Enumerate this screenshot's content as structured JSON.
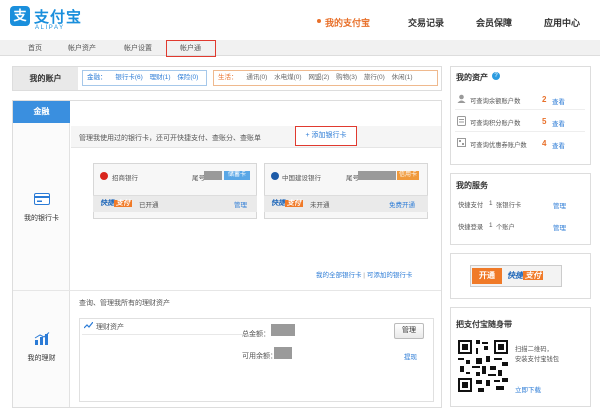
{
  "brand": {
    "logo_glyph": "支",
    "name_cn": "支付宝",
    "name_en": "ALIPAY",
    "color": "#1a8fdc"
  },
  "nav": {
    "items": [
      {
        "label": "我的支付宝",
        "active": true
      },
      {
        "label": "交易记录"
      },
      {
        "label": "会员保障"
      },
      {
        "label": "应用中心"
      }
    ],
    "accent": "#e8702a"
  },
  "subnav": {
    "items": [
      "首页",
      "帐户资产",
      "帐户设置",
      "帐户通"
    ],
    "highlighted": "帐户通"
  },
  "account": {
    "label": "我的账户",
    "finance": {
      "title": "金融：",
      "items": [
        "银行卡(6)",
        "理财(1)",
        "保险(0)"
      ]
    },
    "life": {
      "title": "生活：",
      "items": [
        "通讯(0)",
        "水电煤(0)",
        "网盟(2)",
        "购物(3)",
        "旅行(0)",
        "休闲(1)"
      ]
    }
  },
  "side": {
    "tab_label": "金融",
    "bank_label": "我的银行卡",
    "wealth_label": "我的理财"
  },
  "bank_section": {
    "description": "管理我使用过的银行卡，还可开快捷支付、查账分、查账单",
    "add_card_label": "+ 添加银行卡",
    "cards": [
      {
        "bank": "招商银行",
        "tail_label": "尾号",
        "tag": "储蓄卡",
        "quick_text": "快捷",
        "quick_pay_text": "支付",
        "status": "已开通",
        "action": "管理"
      },
      {
        "bank": "中国建设银行",
        "tail_label": "尾号",
        "tag": "信用卡",
        "quick_text": "快捷",
        "quick_pay_text": "支付",
        "status": "未开通",
        "action": "免费开通"
      }
    ],
    "footer_link_all": "我的全部银行卡",
    "footer_sep": " | ",
    "footer_link_addable": "可添加的银行卡"
  },
  "wealth_section": {
    "description": "查询、管理我所有的理财资产",
    "title": "理财资产",
    "total_label": "总金额：",
    "available_label": "可用余额：",
    "manage_button": "管理",
    "withdraw_link": "提现"
  },
  "assets": {
    "title": "我的资产",
    "rows": [
      {
        "text": "可查询余额账户数",
        "value": "2",
        "link": "查看"
      },
      {
        "text": "可查询积分账户数",
        "value": "5",
        "link": "查看"
      },
      {
        "text": "可查询优惠券账户数",
        "value": "4",
        "link": "查看"
      }
    ]
  },
  "services": {
    "title": "我的服务",
    "rows": [
      {
        "name": "快捷支付",
        "count": "1",
        "unit": "张银行卡",
        "link": "管理"
      },
      {
        "name": "快捷登录",
        "count": "1",
        "unit": "个账户",
        "link": "管理"
      }
    ]
  },
  "promo": {
    "open_label": "开通",
    "quick_text": "快捷",
    "pay_text": "支付"
  },
  "mobile": {
    "title": "把支付宝随身带",
    "scan_text": "扫描二维码，",
    "install_text": "安装支付宝钱包",
    "download_link": "立即下载"
  }
}
